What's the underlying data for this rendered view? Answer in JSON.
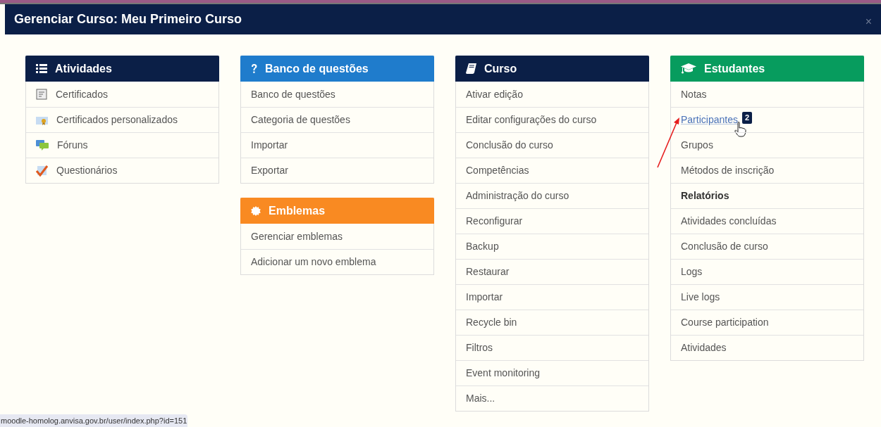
{
  "modal": {
    "title": "Gerenciar Curso: Meu Primeiro Curso",
    "close": "×"
  },
  "columns": [
    [
      {
        "title": "Atividades",
        "color": "#0b1f47",
        "items": [
          {
            "label": "Certificados",
            "kind": "activity"
          },
          {
            "label": "Certificados personalizados",
            "kind": "activity"
          },
          {
            "label": "Fóruns",
            "kind": "activity"
          },
          {
            "label": "Questionários",
            "kind": "activity"
          }
        ]
      }
    ],
    [
      {
        "title": "Banco de questões",
        "color": "#1f7ccc",
        "items": [
          {
            "label": "Banco de questões",
            "kind": "link"
          },
          {
            "label": "Categoria de questões",
            "kind": "link"
          },
          {
            "label": "Importar",
            "kind": "link"
          },
          {
            "label": "Exportar",
            "kind": "link"
          }
        ]
      },
      {
        "title": "Emblemas",
        "color": "#f98a22",
        "items": [
          {
            "label": "Gerenciar emblemas",
            "kind": "link"
          },
          {
            "label": "Adicionar um novo emblema",
            "kind": "link"
          }
        ]
      }
    ],
    [
      {
        "title": "Curso",
        "color": "#0b1f47",
        "items": [
          {
            "label": "Ativar edição",
            "kind": "link"
          },
          {
            "label": "Editar configurações do curso",
            "kind": "link"
          },
          {
            "label": "Conclusão do curso",
            "kind": "link"
          },
          {
            "label": "Competências",
            "kind": "link"
          },
          {
            "label": "Administração do curso",
            "kind": "link"
          },
          {
            "label": "Reconfigurar",
            "kind": "link"
          },
          {
            "label": "Backup",
            "kind": "link"
          },
          {
            "label": "Restaurar",
            "kind": "link"
          },
          {
            "label": "Importar",
            "kind": "link"
          },
          {
            "label": "Recycle bin",
            "kind": "link"
          },
          {
            "label": "Filtros",
            "kind": "link"
          },
          {
            "label": "Event monitoring",
            "kind": "link"
          },
          {
            "label": "Mais...",
            "kind": "link"
          }
        ]
      }
    ],
    [
      {
        "title": "Estudantes",
        "color": "#079c5e",
        "items": [
          {
            "label": "Notas",
            "kind": "link"
          },
          {
            "label": "Participantes",
            "kind": "hover",
            "badge": "2"
          },
          {
            "label": "Grupos",
            "kind": "link"
          },
          {
            "label": "Métodos de inscrição",
            "kind": "link"
          },
          {
            "label": "Relatórios",
            "kind": "heading"
          },
          {
            "label": "Atividades concluídas",
            "kind": "link"
          },
          {
            "label": "Conclusão de curso",
            "kind": "link"
          },
          {
            "label": "Logs",
            "kind": "link"
          },
          {
            "label": "Live logs",
            "kind": "link"
          },
          {
            "label": "Course participation",
            "kind": "link"
          },
          {
            "label": "Atividades",
            "kind": "link"
          }
        ]
      }
    ]
  ],
  "status_bar": {
    "url": "moodle-homolog.anvisa.gov.br/user/index.php?id=151"
  }
}
